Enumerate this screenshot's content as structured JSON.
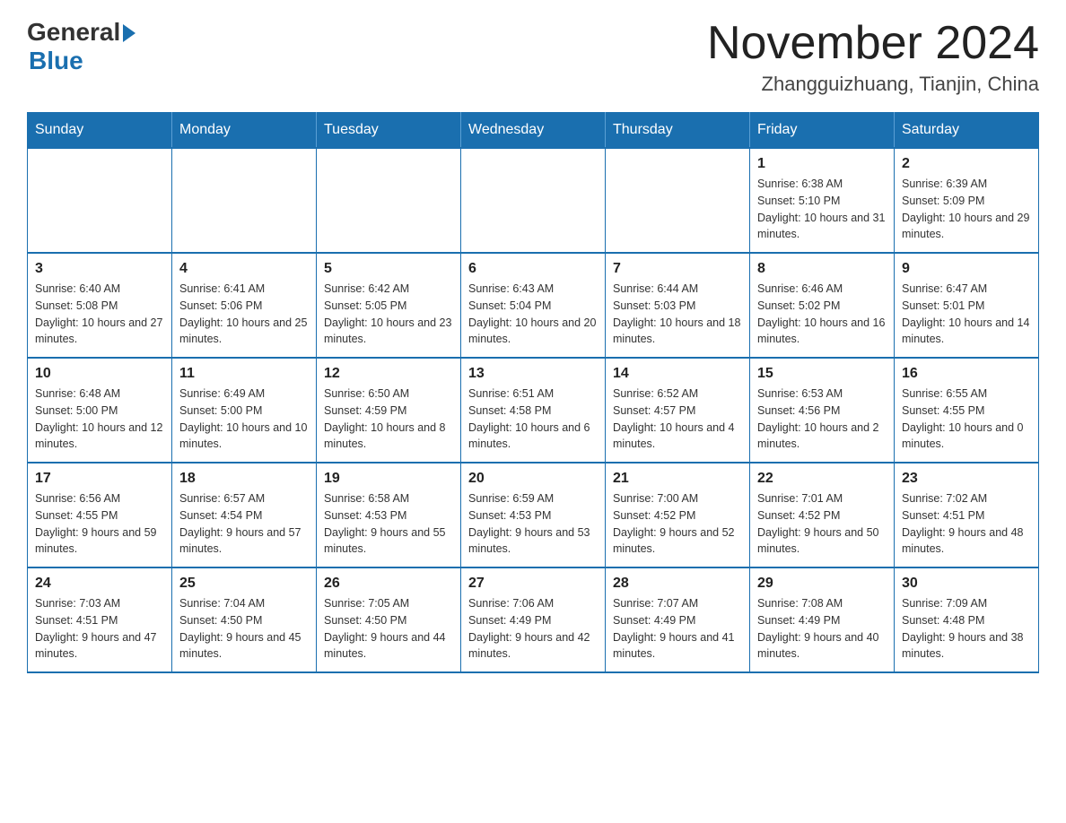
{
  "header": {
    "logo_general": "General",
    "logo_blue": "Blue",
    "month_title": "November 2024",
    "location": "Zhangguizhuang, Tianjin, China"
  },
  "weekdays": [
    "Sunday",
    "Monday",
    "Tuesday",
    "Wednesday",
    "Thursday",
    "Friday",
    "Saturday"
  ],
  "weeks": [
    [
      {
        "day": "",
        "info": ""
      },
      {
        "day": "",
        "info": ""
      },
      {
        "day": "",
        "info": ""
      },
      {
        "day": "",
        "info": ""
      },
      {
        "day": "",
        "info": ""
      },
      {
        "day": "1",
        "info": "Sunrise: 6:38 AM\nSunset: 5:10 PM\nDaylight: 10 hours and 31 minutes."
      },
      {
        "day": "2",
        "info": "Sunrise: 6:39 AM\nSunset: 5:09 PM\nDaylight: 10 hours and 29 minutes."
      }
    ],
    [
      {
        "day": "3",
        "info": "Sunrise: 6:40 AM\nSunset: 5:08 PM\nDaylight: 10 hours and 27 minutes."
      },
      {
        "day": "4",
        "info": "Sunrise: 6:41 AM\nSunset: 5:06 PM\nDaylight: 10 hours and 25 minutes."
      },
      {
        "day": "5",
        "info": "Sunrise: 6:42 AM\nSunset: 5:05 PM\nDaylight: 10 hours and 23 minutes."
      },
      {
        "day": "6",
        "info": "Sunrise: 6:43 AM\nSunset: 5:04 PM\nDaylight: 10 hours and 20 minutes."
      },
      {
        "day": "7",
        "info": "Sunrise: 6:44 AM\nSunset: 5:03 PM\nDaylight: 10 hours and 18 minutes."
      },
      {
        "day": "8",
        "info": "Sunrise: 6:46 AM\nSunset: 5:02 PM\nDaylight: 10 hours and 16 minutes."
      },
      {
        "day": "9",
        "info": "Sunrise: 6:47 AM\nSunset: 5:01 PM\nDaylight: 10 hours and 14 minutes."
      }
    ],
    [
      {
        "day": "10",
        "info": "Sunrise: 6:48 AM\nSunset: 5:00 PM\nDaylight: 10 hours and 12 minutes."
      },
      {
        "day": "11",
        "info": "Sunrise: 6:49 AM\nSunset: 5:00 PM\nDaylight: 10 hours and 10 minutes."
      },
      {
        "day": "12",
        "info": "Sunrise: 6:50 AM\nSunset: 4:59 PM\nDaylight: 10 hours and 8 minutes."
      },
      {
        "day": "13",
        "info": "Sunrise: 6:51 AM\nSunset: 4:58 PM\nDaylight: 10 hours and 6 minutes."
      },
      {
        "day": "14",
        "info": "Sunrise: 6:52 AM\nSunset: 4:57 PM\nDaylight: 10 hours and 4 minutes."
      },
      {
        "day": "15",
        "info": "Sunrise: 6:53 AM\nSunset: 4:56 PM\nDaylight: 10 hours and 2 minutes."
      },
      {
        "day": "16",
        "info": "Sunrise: 6:55 AM\nSunset: 4:55 PM\nDaylight: 10 hours and 0 minutes."
      }
    ],
    [
      {
        "day": "17",
        "info": "Sunrise: 6:56 AM\nSunset: 4:55 PM\nDaylight: 9 hours and 59 minutes."
      },
      {
        "day": "18",
        "info": "Sunrise: 6:57 AM\nSunset: 4:54 PM\nDaylight: 9 hours and 57 minutes."
      },
      {
        "day": "19",
        "info": "Sunrise: 6:58 AM\nSunset: 4:53 PM\nDaylight: 9 hours and 55 minutes."
      },
      {
        "day": "20",
        "info": "Sunrise: 6:59 AM\nSunset: 4:53 PM\nDaylight: 9 hours and 53 minutes."
      },
      {
        "day": "21",
        "info": "Sunrise: 7:00 AM\nSunset: 4:52 PM\nDaylight: 9 hours and 52 minutes."
      },
      {
        "day": "22",
        "info": "Sunrise: 7:01 AM\nSunset: 4:52 PM\nDaylight: 9 hours and 50 minutes."
      },
      {
        "day": "23",
        "info": "Sunrise: 7:02 AM\nSunset: 4:51 PM\nDaylight: 9 hours and 48 minutes."
      }
    ],
    [
      {
        "day": "24",
        "info": "Sunrise: 7:03 AM\nSunset: 4:51 PM\nDaylight: 9 hours and 47 minutes."
      },
      {
        "day": "25",
        "info": "Sunrise: 7:04 AM\nSunset: 4:50 PM\nDaylight: 9 hours and 45 minutes."
      },
      {
        "day": "26",
        "info": "Sunrise: 7:05 AM\nSunset: 4:50 PM\nDaylight: 9 hours and 44 minutes."
      },
      {
        "day": "27",
        "info": "Sunrise: 7:06 AM\nSunset: 4:49 PM\nDaylight: 9 hours and 42 minutes."
      },
      {
        "day": "28",
        "info": "Sunrise: 7:07 AM\nSunset: 4:49 PM\nDaylight: 9 hours and 41 minutes."
      },
      {
        "day": "29",
        "info": "Sunrise: 7:08 AM\nSunset: 4:49 PM\nDaylight: 9 hours and 40 minutes."
      },
      {
        "day": "30",
        "info": "Sunrise: 7:09 AM\nSunset: 4:48 PM\nDaylight: 9 hours and 38 minutes."
      }
    ]
  ]
}
